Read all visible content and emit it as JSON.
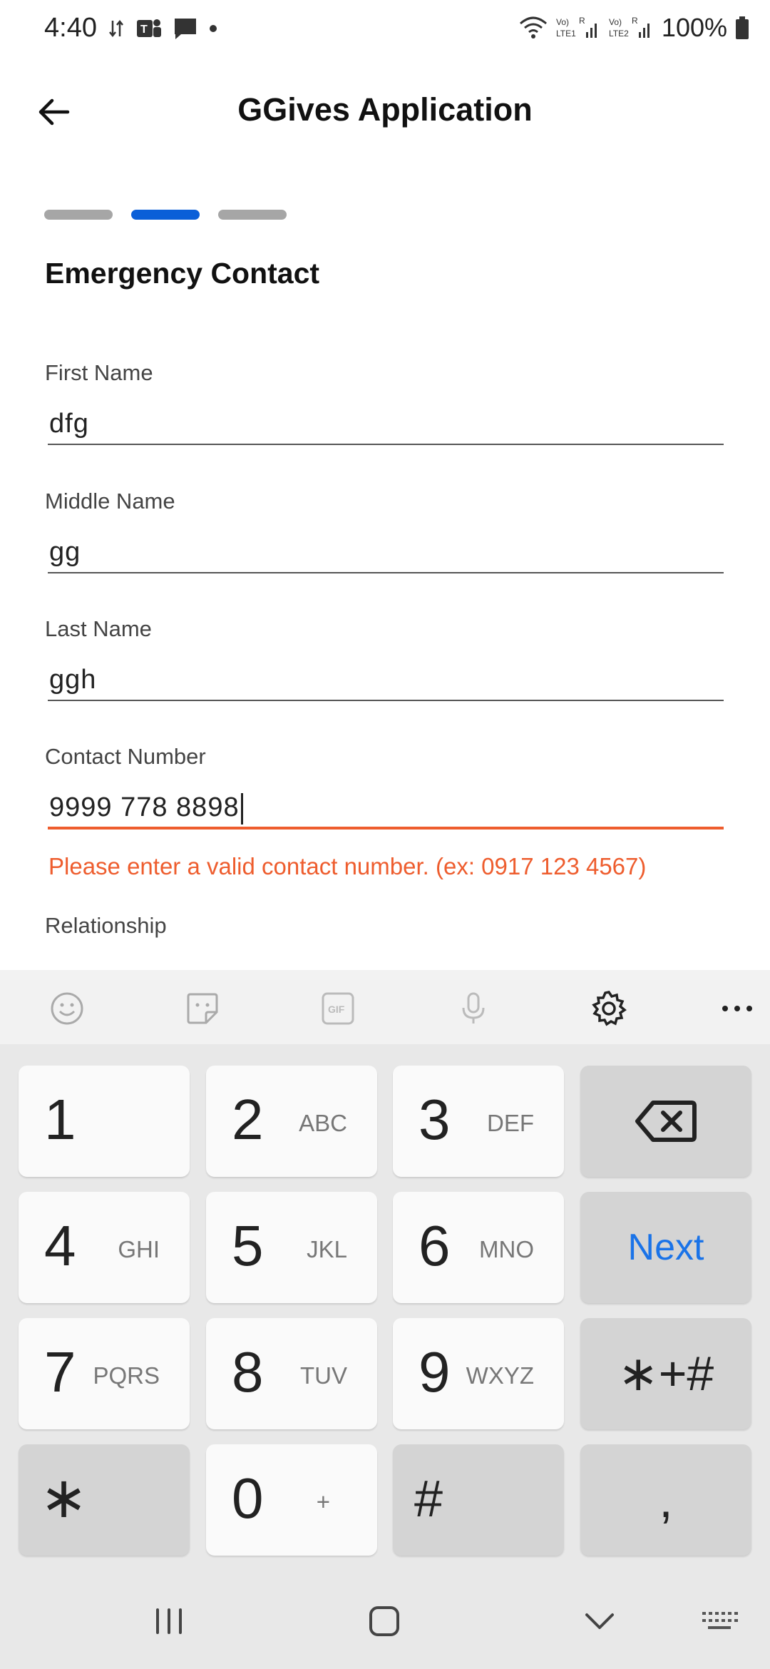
{
  "status_bar": {
    "time": "4:40",
    "battery": "100%",
    "sim1": "Vo) LTE1",
    "sim2": "Vo) LTE2",
    "roaming": "R"
  },
  "app_bar": {
    "title": "GGives Application"
  },
  "stepper": {
    "total_steps": 3,
    "current_step": 2
  },
  "section": {
    "title": "Emergency Contact"
  },
  "form": {
    "first_name": {
      "label": "First Name",
      "value": "dfg"
    },
    "middle_name": {
      "label": "Middle Name",
      "value": "gg"
    },
    "last_name": {
      "label": "Last Name",
      "value": "ggh"
    },
    "contact_number": {
      "label": "Contact Number",
      "value": "9999 778 8898",
      "error": "Please enter a valid contact number. (ex: 0917 123 4567)"
    },
    "relationship": {
      "label": "Relationship"
    }
  },
  "keyboard": {
    "toolbar": [
      "emoji-icon",
      "sticker-icon",
      "gif-icon",
      "microphone-icon",
      "settings-gear-icon",
      "more-icon"
    ],
    "gif_label": "GIF",
    "keys": {
      "k1": {
        "num": "1",
        "sub": ""
      },
      "k2": {
        "num": "2",
        "sub": "ABC"
      },
      "k3": {
        "num": "3",
        "sub": "DEF"
      },
      "k4": {
        "num": "4",
        "sub": "GHI"
      },
      "k5": {
        "num": "5",
        "sub": "JKL"
      },
      "k6": {
        "num": "6",
        "sub": "MNO"
      },
      "k7": {
        "num": "7",
        "sub": "PQRS"
      },
      "k8": {
        "num": "8",
        "sub": "TUV"
      },
      "k9": {
        "num": "9",
        "sub": "WXYZ"
      },
      "k0": {
        "num": "0",
        "sub": "+"
      },
      "star": "∗",
      "hash": "#",
      "symbols": "∗+#",
      "comma": ",",
      "next": "Next"
    }
  },
  "colors": {
    "accent_blue": "#0a5fd8",
    "error_orange": "#ee5d2e",
    "keyboard_next": "#1a73e8"
  }
}
